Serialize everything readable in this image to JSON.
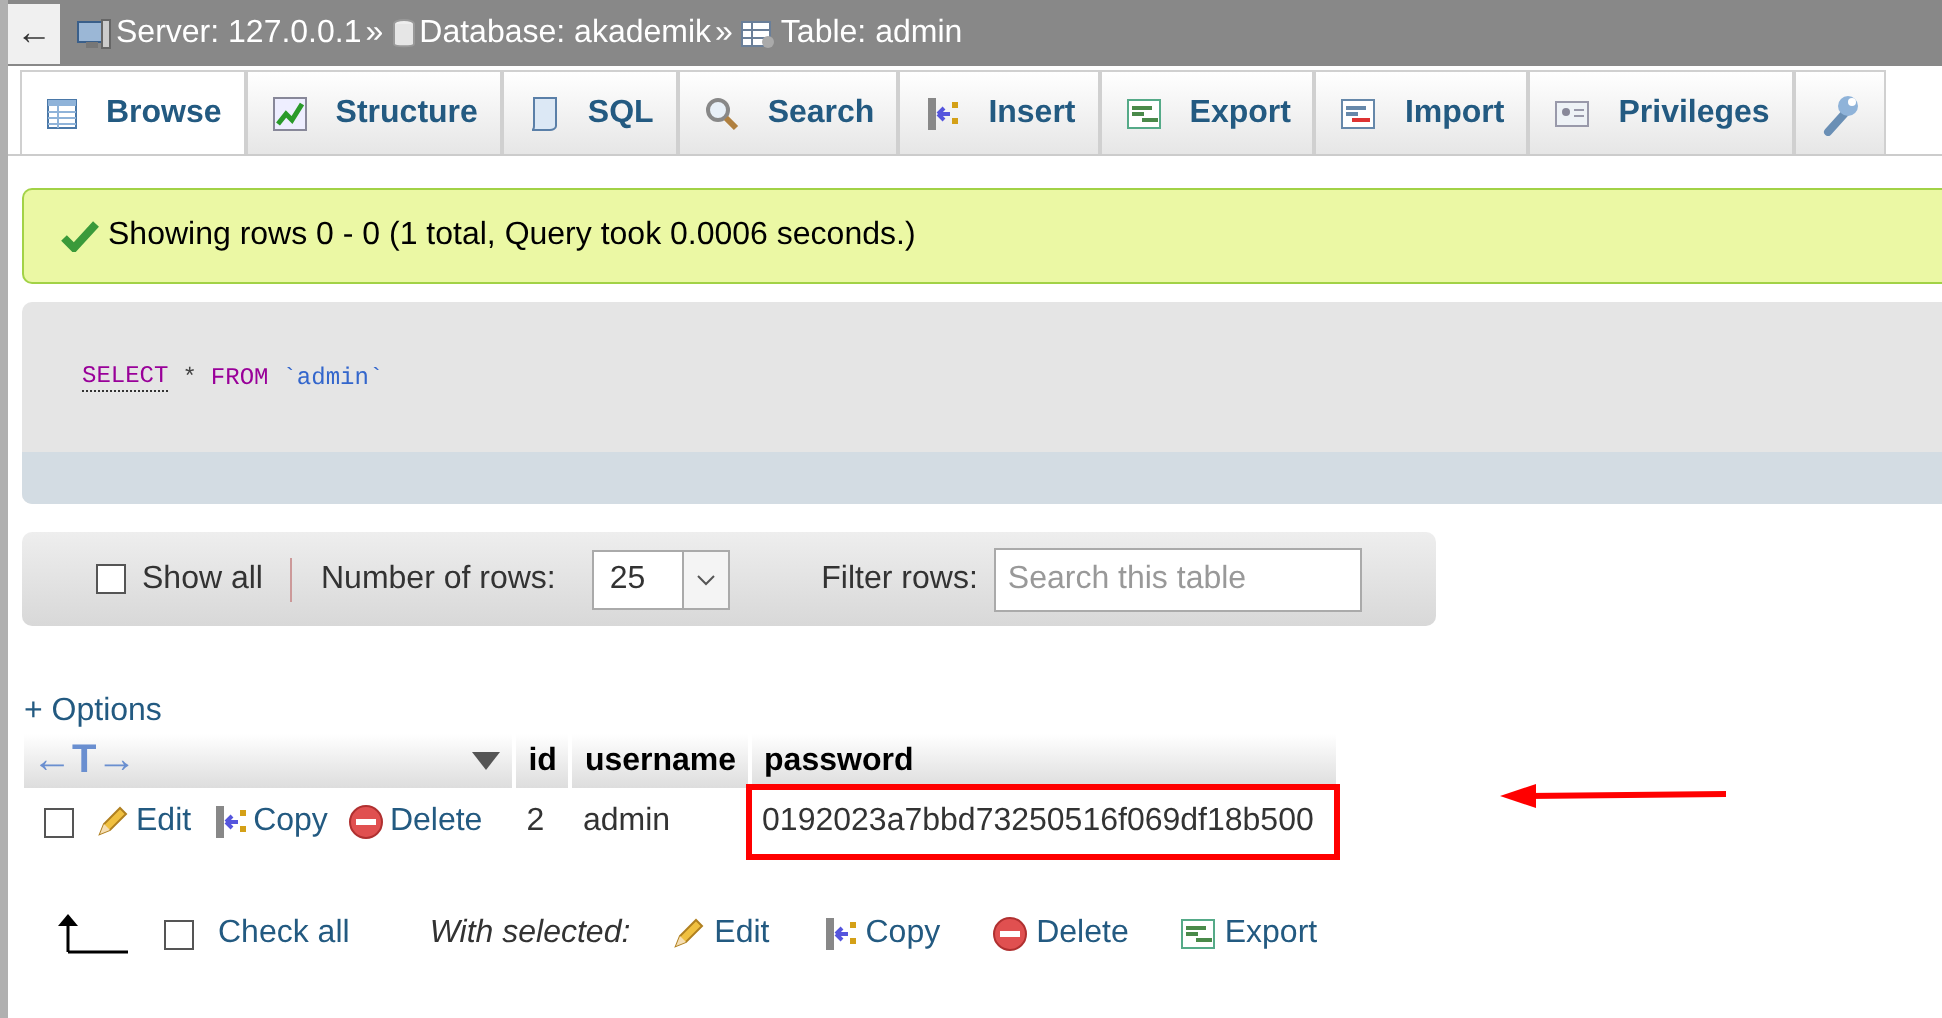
{
  "breadcrumb": {
    "back": "←",
    "items": [
      {
        "label": "Server: 127.0.0.1",
        "separator": "»"
      },
      {
        "label": "Database: akademik",
        "separator": "»"
      },
      {
        "label": "Table: admin"
      }
    ]
  },
  "tabs": [
    {
      "label": "Browse",
      "selected": true
    },
    {
      "label": "Structure",
      "selected": false
    },
    {
      "label": "SQL",
      "selected": false
    },
    {
      "label": "Search",
      "selected": false
    },
    {
      "label": "Insert",
      "selected": false
    },
    {
      "label": "Export",
      "selected": false
    },
    {
      "label": "Import",
      "selected": false
    },
    {
      "label": "Privileges",
      "selected": false
    }
  ],
  "message": {
    "kind": "success",
    "text": "Showing rows 0 - 0 (1 total, Query took 0.0006 seconds.)"
  },
  "query": {
    "tokens": [
      {
        "kind": "keyword",
        "text": "SELECT"
      },
      {
        "kind": "operator",
        "text": "*"
      },
      {
        "kind": "keyword",
        "text": "FROM"
      },
      {
        "kind": "identifier",
        "text": "`admin`"
      }
    ]
  },
  "navigation": {
    "show_all": {
      "label": "Show all",
      "checked": false
    },
    "rows_label": "Number of rows:",
    "rows_value": "25",
    "filter_label": "Filter rows:",
    "filter_placeholder": "Search this table"
  },
  "options_link": "+ Options",
  "table": {
    "arrows": "←T→",
    "columns": [
      "id",
      "username",
      "password"
    ],
    "rows": [
      {
        "checked": false,
        "actions": [
          "Edit",
          "Copy",
          "Delete"
        ],
        "cells": [
          {
            "text": "2",
            "highlighted": false
          },
          {
            "text": "admin",
            "highlighted": false
          },
          {
            "text": "0192023a7bbd73250516f069df18b500",
            "highlighted": true
          }
        ]
      }
    ]
  },
  "footer": {
    "check_all": {
      "label": "Check all",
      "checked": false
    },
    "with_selected": "With selected:",
    "actions": [
      "Edit",
      "Copy",
      "Delete",
      "Export"
    ]
  }
}
